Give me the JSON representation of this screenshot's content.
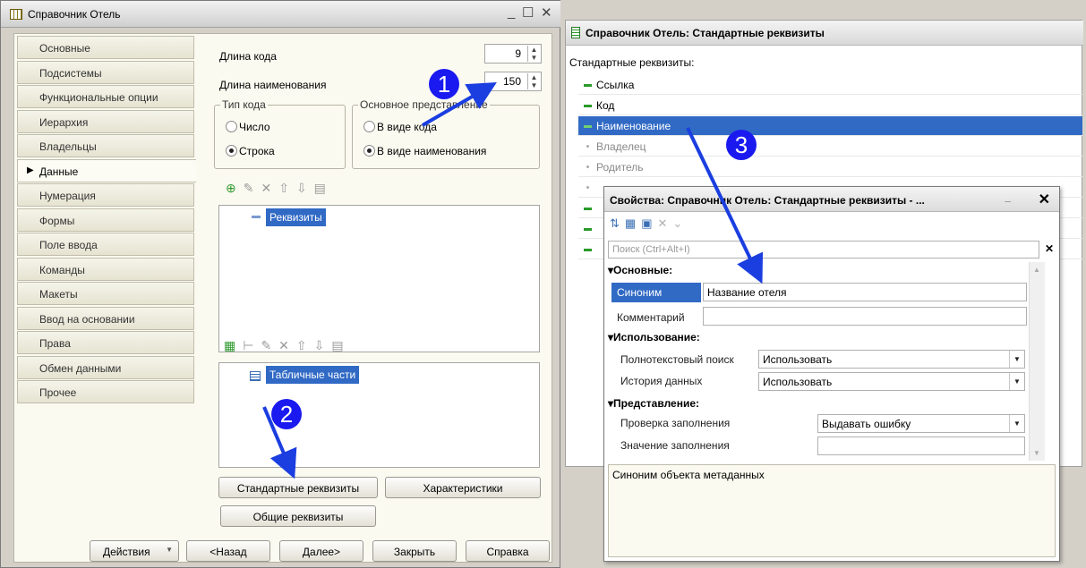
{
  "win1": {
    "title": "Справочник Отель",
    "nav": [
      "Основные",
      "Подсистемы",
      "Функциональные опции",
      "Иерархия",
      "Владельцы",
      "Данные",
      "Нумерация",
      "Формы",
      "Поле ввода",
      "Команды",
      "Макеты",
      "Ввод на основании",
      "Права",
      "Обмен данными",
      "Прочее"
    ],
    "selected_nav": "Данные",
    "code_length_label": "Длина кода",
    "code_length_value": "9",
    "name_length_label": "Длина наименования",
    "name_length_value": "150",
    "code_type": {
      "title": "Тип кода",
      "opt1": "Число",
      "opt2": "Строка",
      "selected": "Строка"
    },
    "main_repr": {
      "title": "Основное представление",
      "opt1": "В виде кода",
      "opt2": "В виде наименования",
      "selected": "В виде наименования"
    },
    "attrs_tree_item": "Реквизиты",
    "tables_tree_item": "Табличные части",
    "buttons": {
      "standard": "Стандартные реквизиты",
      "characteristics": "Характеристики",
      "common": "Общие реквизиты"
    },
    "footer": {
      "actions": "Действия",
      "back": "<Назад",
      "next": "Далее>",
      "close": "Закрыть",
      "help": "Справка"
    }
  },
  "win2": {
    "title": "Справочник Отель: Стандартные реквизиты",
    "list_label": "Стандартные реквизиты:",
    "rows": [
      {
        "label": "Ссылка",
        "kind": "active"
      },
      {
        "label": "Код",
        "kind": "active"
      },
      {
        "label": "Наименование",
        "kind": "selected"
      },
      {
        "label": "Владелец",
        "kind": "gray"
      },
      {
        "label": "Родитель",
        "kind": "gray"
      }
    ]
  },
  "props": {
    "title": "Свойства: Справочник Отель: Стандартные реквизиты - ...",
    "search_placeholder": "Поиск (Ctrl+Alt+I)",
    "sec_main": "Основные:",
    "synonym_label": "Синоним",
    "synonym_value": "Название отеля",
    "comment_label": "Комментарий",
    "sec_usage": "Использование:",
    "fulltext_label": "Полнотекстовый поиск",
    "fulltext_value": "Использовать",
    "history_label": "История данных",
    "history_value": "Использовать",
    "sec_view": "Представление:",
    "fill_check_label": "Проверка заполнения",
    "fill_check_value": "Выдавать ошибку",
    "fill_value_label": "Значение заполнения",
    "hint": "Синоним объекта метаданных"
  },
  "badges": [
    "1",
    "2",
    "3"
  ],
  "colors": {
    "selection": "#316ac5",
    "badge": "#1a1af0",
    "arrow": "#1a3ee0"
  }
}
